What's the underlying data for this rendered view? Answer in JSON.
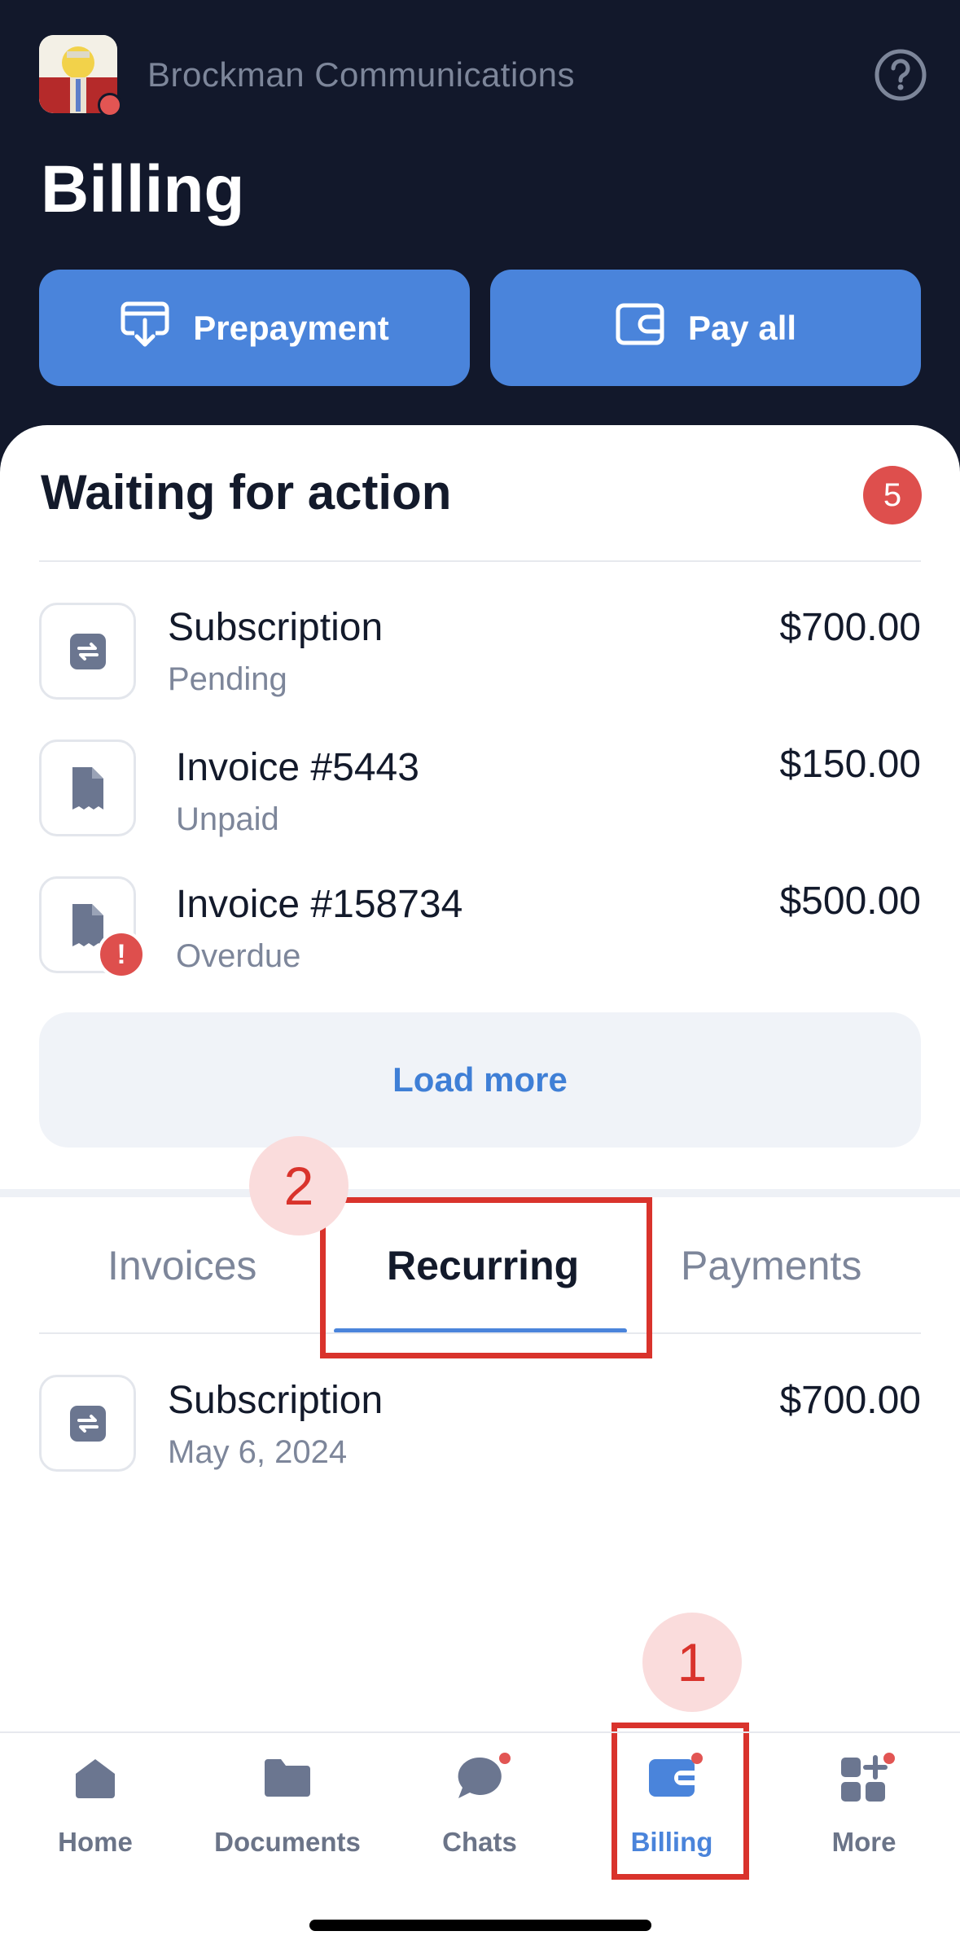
{
  "header": {
    "company_name": "Brockman Communications",
    "page_title": "Billing",
    "help_icon": "question-circle-icon"
  },
  "actions": {
    "prepayment_label": "Prepayment",
    "pay_all_label": "Pay all"
  },
  "waiting": {
    "title": "Waiting for action",
    "count": "5",
    "items": [
      {
        "icon": "recurring-icon",
        "title": "Subscription",
        "status": "Pending",
        "amount": "$700.00"
      },
      {
        "icon": "invoice-icon",
        "title": "Invoice #5443",
        "status": "Unpaid",
        "amount": "$150.00"
      },
      {
        "icon": "invoice-icon",
        "title": "Invoice #158734",
        "status": "Overdue",
        "amount": "$500.00",
        "warning": "!"
      }
    ],
    "load_more_label": "Load more"
  },
  "tabs": [
    {
      "label": "Invoices",
      "active": false
    },
    {
      "label": "Recurring",
      "active": true
    },
    {
      "label": "Payments",
      "active": false
    }
  ],
  "recurring": {
    "items": [
      {
        "icon": "recurring-icon",
        "title": "Subscription",
        "date": "May 6, 2024",
        "amount": "$700.00"
      }
    ]
  },
  "annotations": {
    "step1": "1",
    "step2": "2"
  },
  "nav": [
    {
      "label": "Home",
      "icon": "home-icon",
      "active": false,
      "dot": false
    },
    {
      "label": "Documents",
      "icon": "folder-icon",
      "active": false,
      "dot": false
    },
    {
      "label": "Chats",
      "icon": "chat-icon",
      "active": false,
      "dot": true
    },
    {
      "label": "Billing",
      "icon": "wallet-icon",
      "active": true,
      "dot": true
    },
    {
      "label": "More",
      "icon": "grid-plus-icon",
      "active": false,
      "dot": true
    }
  ],
  "colors": {
    "header_bg": "#12182b",
    "accent": "#4a84db",
    "alert": "#de4f4d",
    "annotation": "#d9332c"
  }
}
